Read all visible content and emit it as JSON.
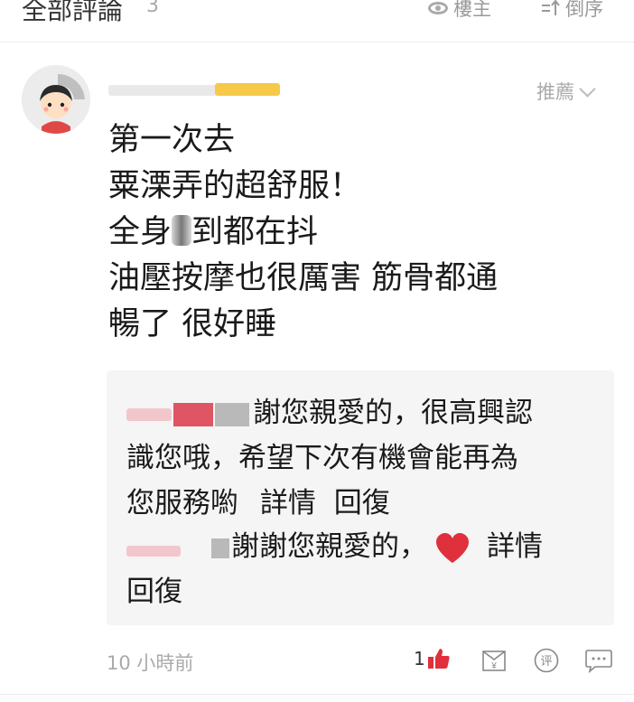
{
  "header": {
    "title": "全部評論",
    "count": "3",
    "author_label": "樓主",
    "sort_label": "倒序"
  },
  "comment": {
    "recommend_label": "推薦",
    "lines": [
      "第一次去",
      "粟溧弄的超舒服！",
      "全身",
      "到都在抖",
      "油壓按摩也很厲害 筋骨都通",
      "暢了 很好睡"
    ],
    "replies": [
      {
        "text_line1": "謝您親愛的，很高興認",
        "text_line2": "識您哦，希望下次有機會能再為",
        "text_line3": "您服務喲",
        "details": "詳情",
        "reply": "回復"
      },
      {
        "text": "謝謝您親愛的，",
        "details": "詳情",
        "reply": "回復"
      }
    ],
    "timestamp": "10 小時前",
    "like_count": "1"
  },
  "colors": {
    "accent_red": "#e0303c",
    "muted_gray": "#aaaaaa",
    "reply_bg": "#f5f5f5"
  },
  "icons": [
    "eye-icon",
    "sort-icon",
    "chevron-down-icon",
    "heart-icon",
    "thumbs-up-icon",
    "gift-yen-icon",
    "evaluate-icon",
    "chat-bubble-icon"
  ]
}
